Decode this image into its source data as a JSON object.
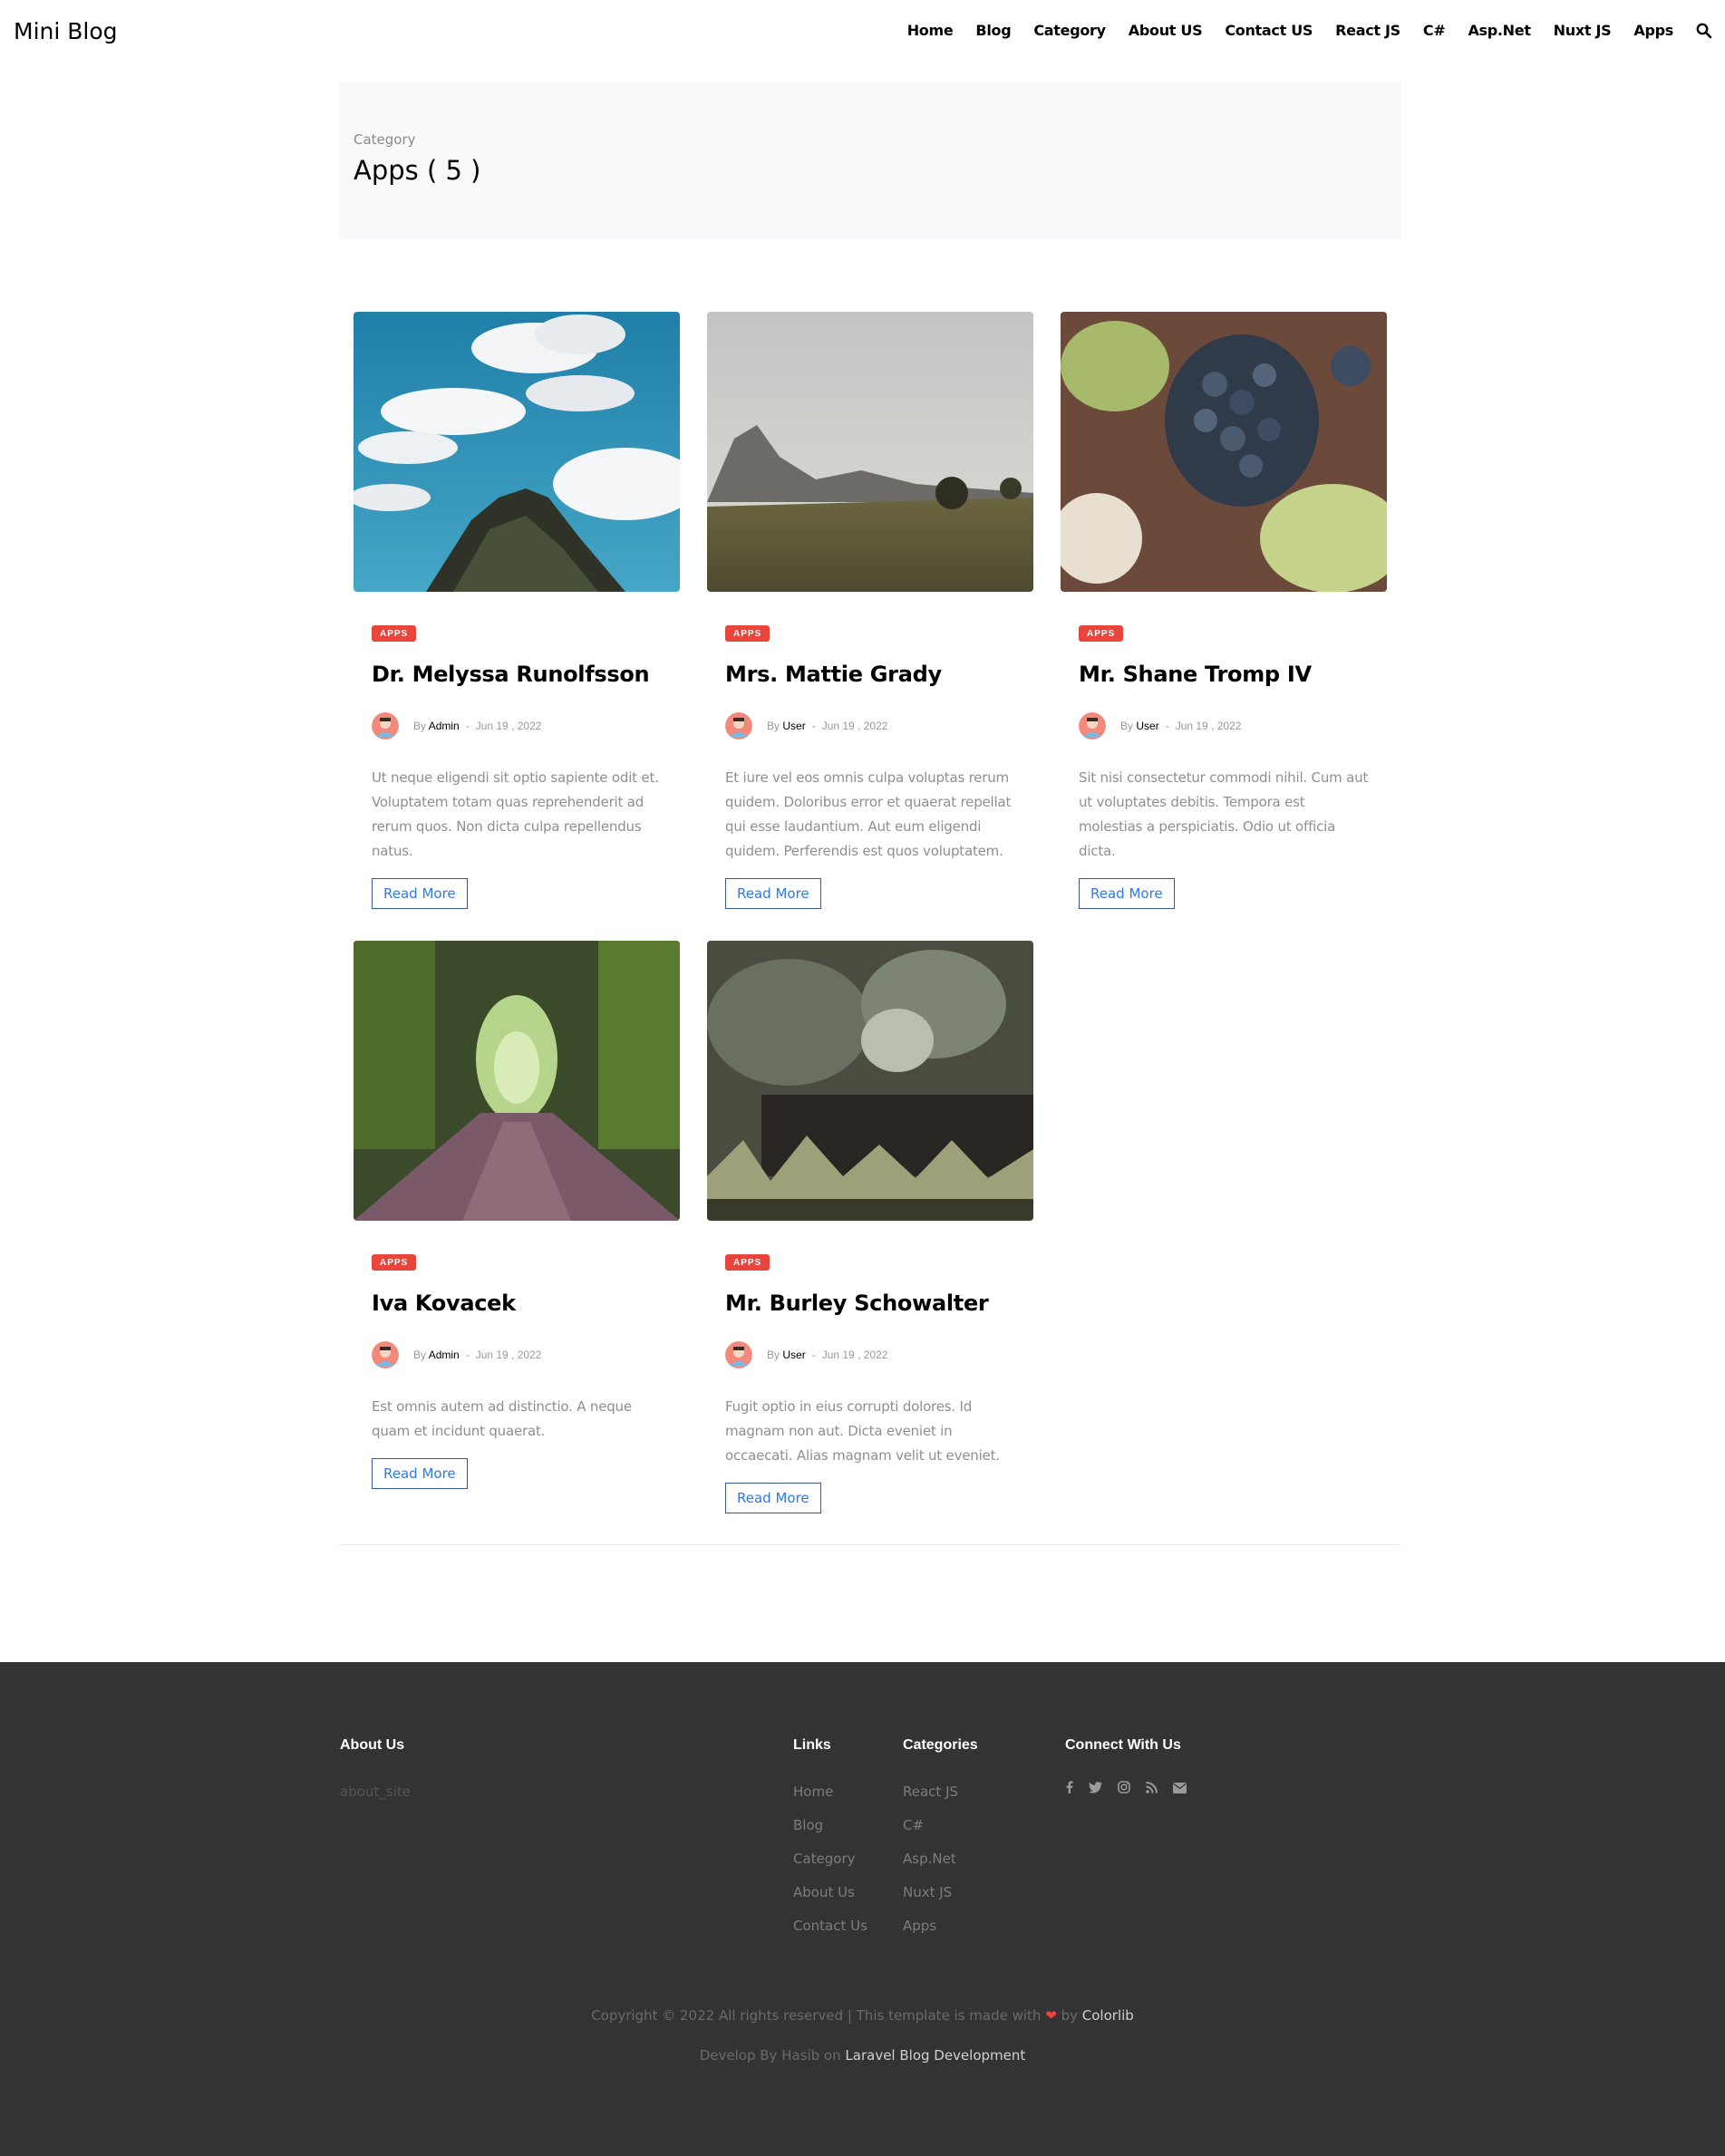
{
  "header": {
    "logo": "Mini Blog",
    "nav": [
      "Home",
      "Blog",
      "Category",
      "About US",
      "Contact US",
      "React JS",
      "C#",
      "Asp.Net",
      "Nuxt JS",
      "Apps"
    ]
  },
  "hero": {
    "label": "Category",
    "title": "Apps ( 5 )"
  },
  "posts": [
    {
      "badge": "APPS",
      "title": "Dr. Melyssa Runolfsson",
      "by": "By",
      "author": "Admin",
      "date": "Jun 19 , 2022",
      "excerpt": "Ut neque eligendi sit optio sapiente odit et. Voluptatem totam quas reprehenderit ad rerum quos. Non dicta culpa repellendus natus.",
      "read_more": "Read More",
      "image": "sky-clouds-hilltop"
    },
    {
      "badge": "APPS",
      "title": "Mrs. Mattie Grady",
      "by": "By",
      "author": "User",
      "date": "Jun 19 , 2022",
      "excerpt": "Et iure vel eos omnis culpa voluptas rerum quidem. Doloribus error et quaerat repellat qui esse laudantium. Aut eum eligendi quidem. Perferendis est quos voluptatem.",
      "read_more": "Read More",
      "image": "mountain-meadow"
    },
    {
      "badge": "APPS",
      "title": "Mr. Shane Tromp IV",
      "by": "By",
      "author": "User",
      "date": "Jun 19 , 2022",
      "excerpt": "Sit nisi consectetur commodi nihil. Cum aut ut voluptates debitis. Tempora est molestias a perspiciatis. Odio ut officia dicta.",
      "read_more": "Read More",
      "image": "grapes"
    },
    {
      "badge": "APPS",
      "title": "Iva Kovacek",
      "by": "By",
      "author": "Admin",
      "date": "Jun 19 , 2022",
      "excerpt": "Est omnis autem ad distinctio. A neque quam et incidunt quaerat.",
      "read_more": "Read More",
      "image": "forest-path"
    },
    {
      "badge": "APPS",
      "title": "Mr. Burley Schowalter",
      "by": "By",
      "author": "User",
      "date": "Jun 19 , 2022",
      "excerpt": "Fugit optio in eius corrupti dolores. Id magnam non aut. Dicta eveniet in occaecati. Alias magnam velit ut eveniet.",
      "read_more": "Read More",
      "image": "grass-closeup"
    }
  ],
  "footer": {
    "about_heading": "About Us",
    "about_text": "about_site",
    "links_heading": "Links",
    "links": [
      "Home",
      "Blog",
      "Category",
      "About Us",
      "Contact Us"
    ],
    "categories_heading": "Categories",
    "categories": [
      "React JS",
      "C#",
      "Asp.Net",
      "Nuxt JS",
      "Apps"
    ],
    "connect_heading": "Connect With Us",
    "social_icons": [
      "facebook-icon",
      "twitter-icon",
      "instagram-icon",
      "rss-icon",
      "envelope-icon"
    ],
    "copyright_prefix": "Copyright © 2022 All rights reserved | This template is made with",
    "copyright_by": "by",
    "copyright_brand": "Colorlib",
    "developed_prefix": "Develop By Hasib on",
    "developed_link": "Laravel Blog Development"
  },
  "colors": {
    "badge": "#e8463c",
    "footer_bg": "#333333",
    "hero_bg": "#f8f9fa",
    "link_blue": "#2f7be5"
  }
}
